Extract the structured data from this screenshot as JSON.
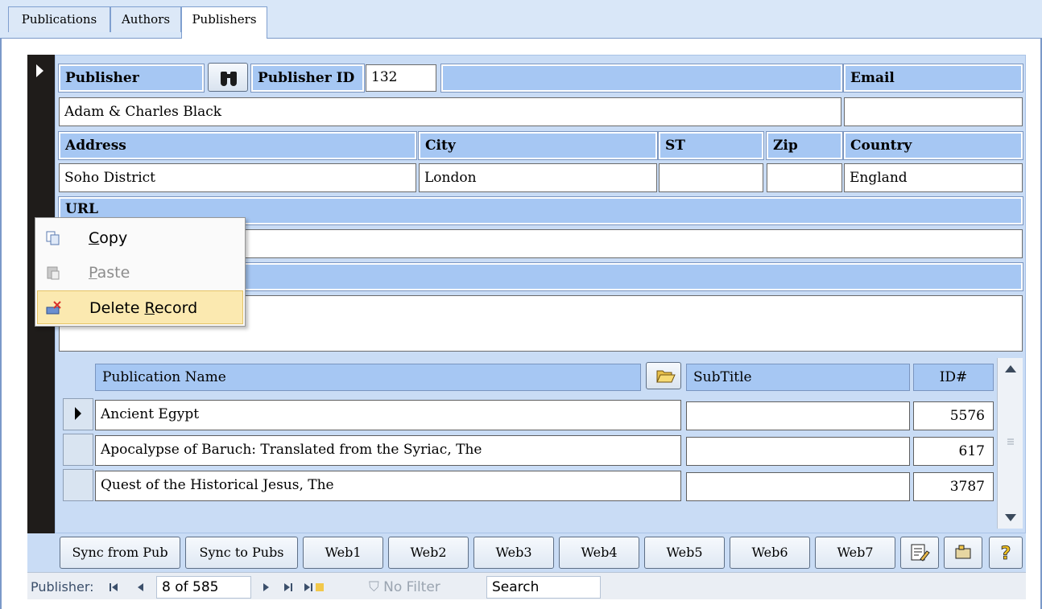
{
  "tabs": [
    {
      "label": "Publications"
    },
    {
      "label": "Authors"
    },
    {
      "label": "Publishers"
    }
  ],
  "form": {
    "publisher_label": "Publisher",
    "publisher_id_label": "Publisher ID",
    "publisher_id_value": "132",
    "email_label": "Email",
    "publisher_value": "Adam & Charles Black",
    "email_value": "",
    "address_label": "Address",
    "city_label": "City",
    "st_label": "ST",
    "zip_label": "Zip",
    "country_label": "Country",
    "address_value": "Soho District",
    "city_value": "London",
    "st_value": "",
    "zip_value": "",
    "country_value": "England",
    "url_label": "URL"
  },
  "subform": {
    "headers": {
      "name": "Publication Name",
      "subtitle": "SubTitle",
      "id": "ID#"
    },
    "rows": [
      {
        "name": "Ancient Egypt",
        "subtitle": "",
        "id": "5576"
      },
      {
        "name": "Apocalypse of Baruch: Translated from the Syriac, The",
        "subtitle": "",
        "id": "617"
      },
      {
        "name": "Quest of the Historical Jesus, The",
        "subtitle": "",
        "id": "3787"
      }
    ]
  },
  "buttons": {
    "sync_from_pub": "Sync from Pub",
    "sync_to_pubs": "Sync to Pubs",
    "web1": "Web1",
    "web2": "Web2",
    "web3": "Web3",
    "web4": "Web4",
    "web5": "Web5",
    "web6": "Web6",
    "web7": "Web7"
  },
  "navbar": {
    "label": "Publisher:",
    "record": "8 of 585",
    "filter": "No Filter",
    "search_placeholder": "Search"
  },
  "context_menu": {
    "copy": {
      "pre": "",
      "u": "C",
      "post": "opy"
    },
    "paste": {
      "pre": "",
      "u": "P",
      "post": "aste"
    },
    "delete": {
      "pre": "Delete ",
      "u": "R",
      "post": "ecord"
    }
  },
  "colors": {
    "label_bg": "#a6c7f3",
    "panel_bg": "#c9dcf5",
    "highlight": "#fbe9b0"
  }
}
